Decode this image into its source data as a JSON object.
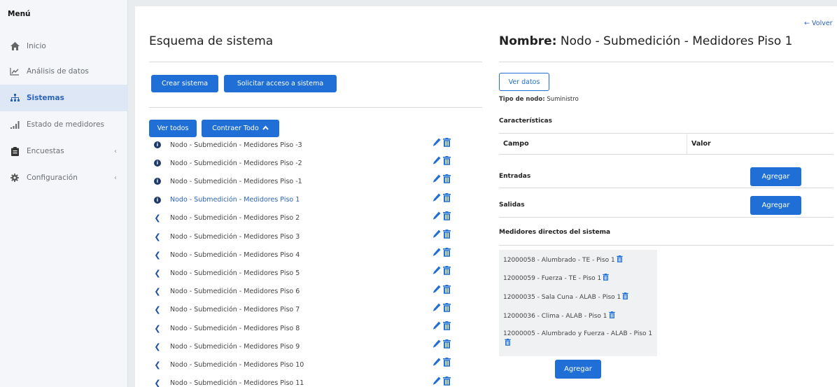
{
  "sidebar": {
    "title": "Menú",
    "items": [
      {
        "label": "Inicio",
        "icon": "home-icon"
      },
      {
        "label": "Análisis de datos",
        "icon": "chart-line-icon"
      },
      {
        "label": "Sistemas",
        "icon": "sitemap-icon"
      },
      {
        "label": "Estado de medidores",
        "icon": "signal-icon"
      },
      {
        "label": "Encuestas",
        "icon": "clipboard-icon"
      },
      {
        "label": "Configuración",
        "icon": "gear-icon"
      }
    ],
    "active_index": 2
  },
  "left": {
    "title": "Esquema de sistema",
    "create_button": "Crear sistema",
    "request_button": "Solicitar acceso a sistema",
    "view_all_button": "Ver todos",
    "collapse_button": "Contraer Todo",
    "nodes": [
      {
        "label": "Nodo - Submedición - Medidores Piso -3",
        "icon": "info"
      },
      {
        "label": "Nodo - Submedición - Medidores Piso -2",
        "icon": "info"
      },
      {
        "label": "Nodo - Submedición - Medidores Piso -1",
        "icon": "info"
      },
      {
        "label": "Nodo - Submedición - Medidores Piso 1",
        "icon": "info",
        "active": true
      },
      {
        "label": "Nodo - Submedición - Medidores Piso 2",
        "icon": "chevron"
      },
      {
        "label": "Nodo - Submedición - Medidores Piso 3",
        "icon": "chevron"
      },
      {
        "label": "Nodo - Submedición - Medidores Piso 4",
        "icon": "chevron"
      },
      {
        "label": "Nodo - Submedición - Medidores Piso 5",
        "icon": "chevron"
      },
      {
        "label": "Nodo - Submedición - Medidores Piso 6",
        "icon": "chevron"
      },
      {
        "label": "Nodo - Submedición - Medidores Piso 7",
        "icon": "chevron"
      },
      {
        "label": "Nodo - Submedición - Medidores Piso 8",
        "icon": "chevron"
      },
      {
        "label": "Nodo - Submedición - Medidores Piso 9",
        "icon": "chevron"
      },
      {
        "label": "Nodo - Submedición - Medidores Piso 10",
        "icon": "chevron"
      },
      {
        "label": "Nodo - Submedición - Medidores Piso 11",
        "icon": "chevron"
      }
    ]
  },
  "right": {
    "back_link": "Volver",
    "name_prefix": "Nombre:",
    "name_value": "Nodo - Submedición - Medidores Piso 1",
    "view_data_button": "Ver datos",
    "node_type_label": "Tipo de nodo:",
    "node_type_value": "Suministro",
    "characteristics_label": "Características",
    "table_headers": {
      "field": "Campo",
      "value": "Valor"
    },
    "inputs_label": "Entradas",
    "outputs_label": "Salidas",
    "add_button": "Agregar",
    "meters_label": "Medidores directos del sistema",
    "meters": [
      "12000058 - Alumbrado - TE - Piso 1",
      "12000059 - Fuerza - TE - Piso 1",
      "12000035 - Sala Cuna - ALAB - Piso 1",
      "12000036 - Clima - ALAB - Piso 1",
      "12000005 - Alumbrado y Fuerza - ALAB - Piso 1"
    ]
  },
  "colors": {
    "primary": "#1f6fd6",
    "active_bg": "#dde7f5",
    "link": "#2c63b8"
  }
}
